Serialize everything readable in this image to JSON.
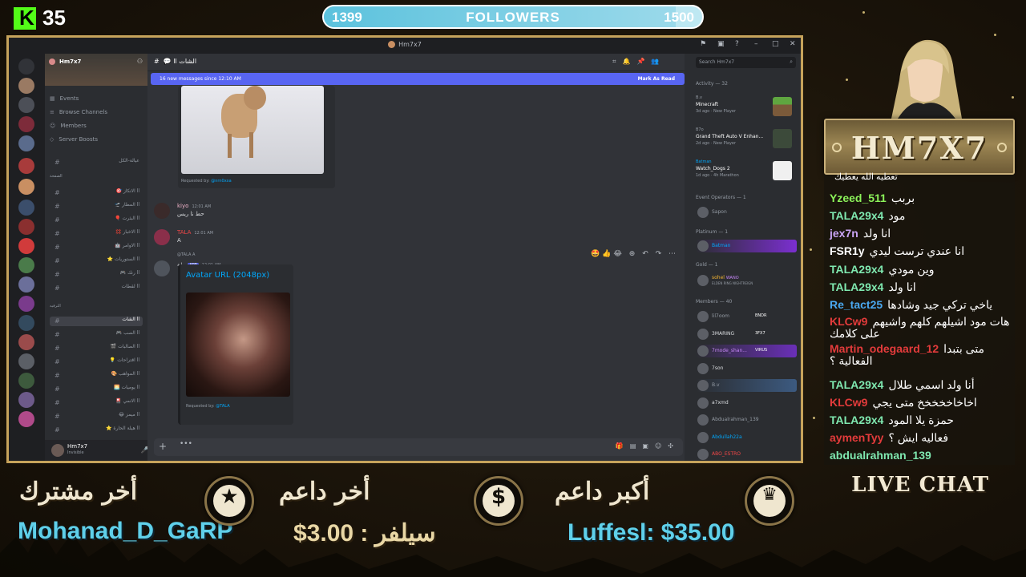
{
  "kick": {
    "logo": "K",
    "count": "35"
  },
  "followers": {
    "current": "1399",
    "label": "FOLLOWERS",
    "goal": "1500",
    "progress": 0.93
  },
  "discord": {
    "window_title": "Hm7x7",
    "server_name": "Hm7x7",
    "server_menu": [
      {
        "icon": "calendar-icon",
        "label": "Events"
      },
      {
        "icon": "channels-icon",
        "label": "Browse Channels"
      },
      {
        "icon": "members-icon",
        "label": "Members"
      },
      {
        "icon": "boost-icon",
        "label": "Server Boosts"
      }
    ],
    "categories": [
      "الصفحة",
      "الترفيه"
    ],
    "channels_group1": [
      "عيالة-الكل",
      "ll الانكاز 🎯",
      "ll المطار 🛫",
      "ll البثرت 🎈",
      "ll الاخبار 💢",
      "ll الاوامر 🤖",
      "ll الستوريات ⭐",
      "ll رنك 🎮",
      "ll لقطات"
    ],
    "channels_group2": [
      "ll الشات",
      "ll الصب 🎮",
      "ll الصالبات 🎬",
      "ll اقتراحات 💡",
      "ll المواهب 🎨",
      "ll يوميات 🌅",
      "ll الانمي 🎴",
      "ll ميمز 😂",
      "ll هيلة الحارة ⭐"
    ],
    "channel_header": "ll الشات",
    "new_messages_bar": {
      "text": "16 new messages since 12:10 AM",
      "action": "Mark As Read"
    },
    "search_placeholder": "Search Hm7x7",
    "user": {
      "name": "Hm7x7",
      "status": "Invisible"
    },
    "messages": [
      {
        "requested_label": "Requested by:",
        "requested_by": "@nrn0xxa"
      },
      {
        "author": "kiyo",
        "time": "12:01 AM",
        "text": "حط نا ريس",
        "color": "#f0b3c8"
      },
      {
        "author": "TALA",
        "time": "12:01 AM",
        "text": "A",
        "color": "#f04747"
      },
      {
        "author": "بوابة",
        "badge": "APP",
        "time": "12:01 AM",
        "reply": "@TALA A",
        "embed_title": "Avatar URL (2048px)",
        "requested_label": "Requested by:",
        "requested_by": "@TALA"
      }
    ],
    "activity": {
      "header": "Activity — 32",
      "games": [
        {
          "user": "B.v",
          "game": "Minecraft",
          "meta": "3d ago · New Player"
        },
        {
          "user": "B7o",
          "game": "Grand Theft Auto V Enhan...",
          "meta": "2d ago · New Player"
        },
        {
          "user": "Batman",
          "game": "Watch_Dogs 2",
          "meta": "1d ago · 4h Marathon"
        }
      ],
      "sections": [
        {
          "title": "Event Operators — 1",
          "members": [
            {
              "name": "Sapon",
              "color": "#949ba4"
            }
          ]
        },
        {
          "title": "Platinum — 1",
          "members": [
            {
              "name": "Batman",
              "color": "#00a8fc"
            }
          ]
        },
        {
          "title": "Gold — 1",
          "members": [
            {
              "name": "sohel",
              "tag": "WANO",
              "sub": "ELDEN RING NIGHTREIGN",
              "color": "#f0b232"
            }
          ]
        },
        {
          "title": "Members — 40",
          "members": [
            {
              "name": "lil7oom",
              "tag": "BNDR",
              "color": "#949ba4"
            },
            {
              "name": "3MARING",
              "tag": "3FX7",
              "color": "#dbdee1"
            },
            {
              "name": "7mode_shan...",
              "tag": "VIRUS",
              "color": "#c586f5"
            },
            {
              "name": "7son",
              "color": "#dbdee1"
            },
            {
              "name": "B.v",
              "color": "#949ba4"
            },
            {
              "name": "a7xmd",
              "color": "#dbdee1"
            },
            {
              "name": "Abdualrahman_139",
              "color": "#949ba4"
            },
            {
              "name": "Abdullah22a",
              "color": "#00a8fc"
            },
            {
              "name": "ABO_ESTRO",
              "color": "#f04747"
            }
          ]
        }
      ]
    }
  },
  "channel_title": "HM7X7",
  "chat": [
    {
      "user": "",
      "msg": "تعطيه الله يعطيك",
      "color": "#e6e6e6"
    },
    {
      "user": "Yzeed_511",
      "msg": "بربب",
      "color": "#8cf25a"
    },
    {
      "user": "TALA29x4",
      "msg": "مود",
      "color": "#7fe8b0"
    },
    {
      "user": "jex7n",
      "msg": "انا ولد",
      "color": "#c9a4f4"
    },
    {
      "user": "FSR1y",
      "msg": "انا عندي ترست ليدي",
      "color": "#ffffff"
    },
    {
      "user": "TALA29x4",
      "msg": "وين مودي",
      "color": "#7fe8b0"
    },
    {
      "user": "TALA29x4",
      "msg": "انا ولد",
      "color": "#7fe8b0"
    },
    {
      "user": "Re_tact25",
      "msg": "ياخي تركي جيد وشادها",
      "color": "#4aa8f0"
    },
    {
      "user": "KLCw9",
      "msg": "هات مود اشيلهم كلهم واشيهم على كلامك",
      "color": "#e33b3b"
    },
    {
      "user": "Martin_odegaard_12",
      "msg": "متى بتبدا الفعالية ؟",
      "color": "#e33b3b"
    },
    {
      "user": "TALA29x4",
      "msg": "أنا ولد اسمي طلال",
      "color": "#7fe8b0"
    },
    {
      "user": "KLCw9",
      "msg": "اخاخاخخخخخ متى يجي",
      "color": "#e33b3b"
    },
    {
      "user": "TALA29x4",
      "msg": "حمزة يلا المود",
      "color": "#7fe8b0"
    },
    {
      "user": "aymenTyy",
      "msg": "فعاليه ايش ؟",
      "color": "#e33b3b"
    },
    {
      "user": "abdualrahman_139",
      "msg": "",
      "color": "#7fe8b0"
    }
  ],
  "live_chat_label": "LIVE CHAT",
  "bottom": {
    "last_sub_label": "أخر مشترك",
    "last_sub_name": "Mohanad_D_GaRP",
    "last_tip_label": "أخر داعم",
    "last_tip_value": "سيلفر : 3.00$",
    "top_tip_label": "أكبر داعم",
    "top_tip_value": "Luffesl: $35.00",
    "icons": [
      "star-icon",
      "dollar-icon",
      "crown-icon"
    ]
  }
}
